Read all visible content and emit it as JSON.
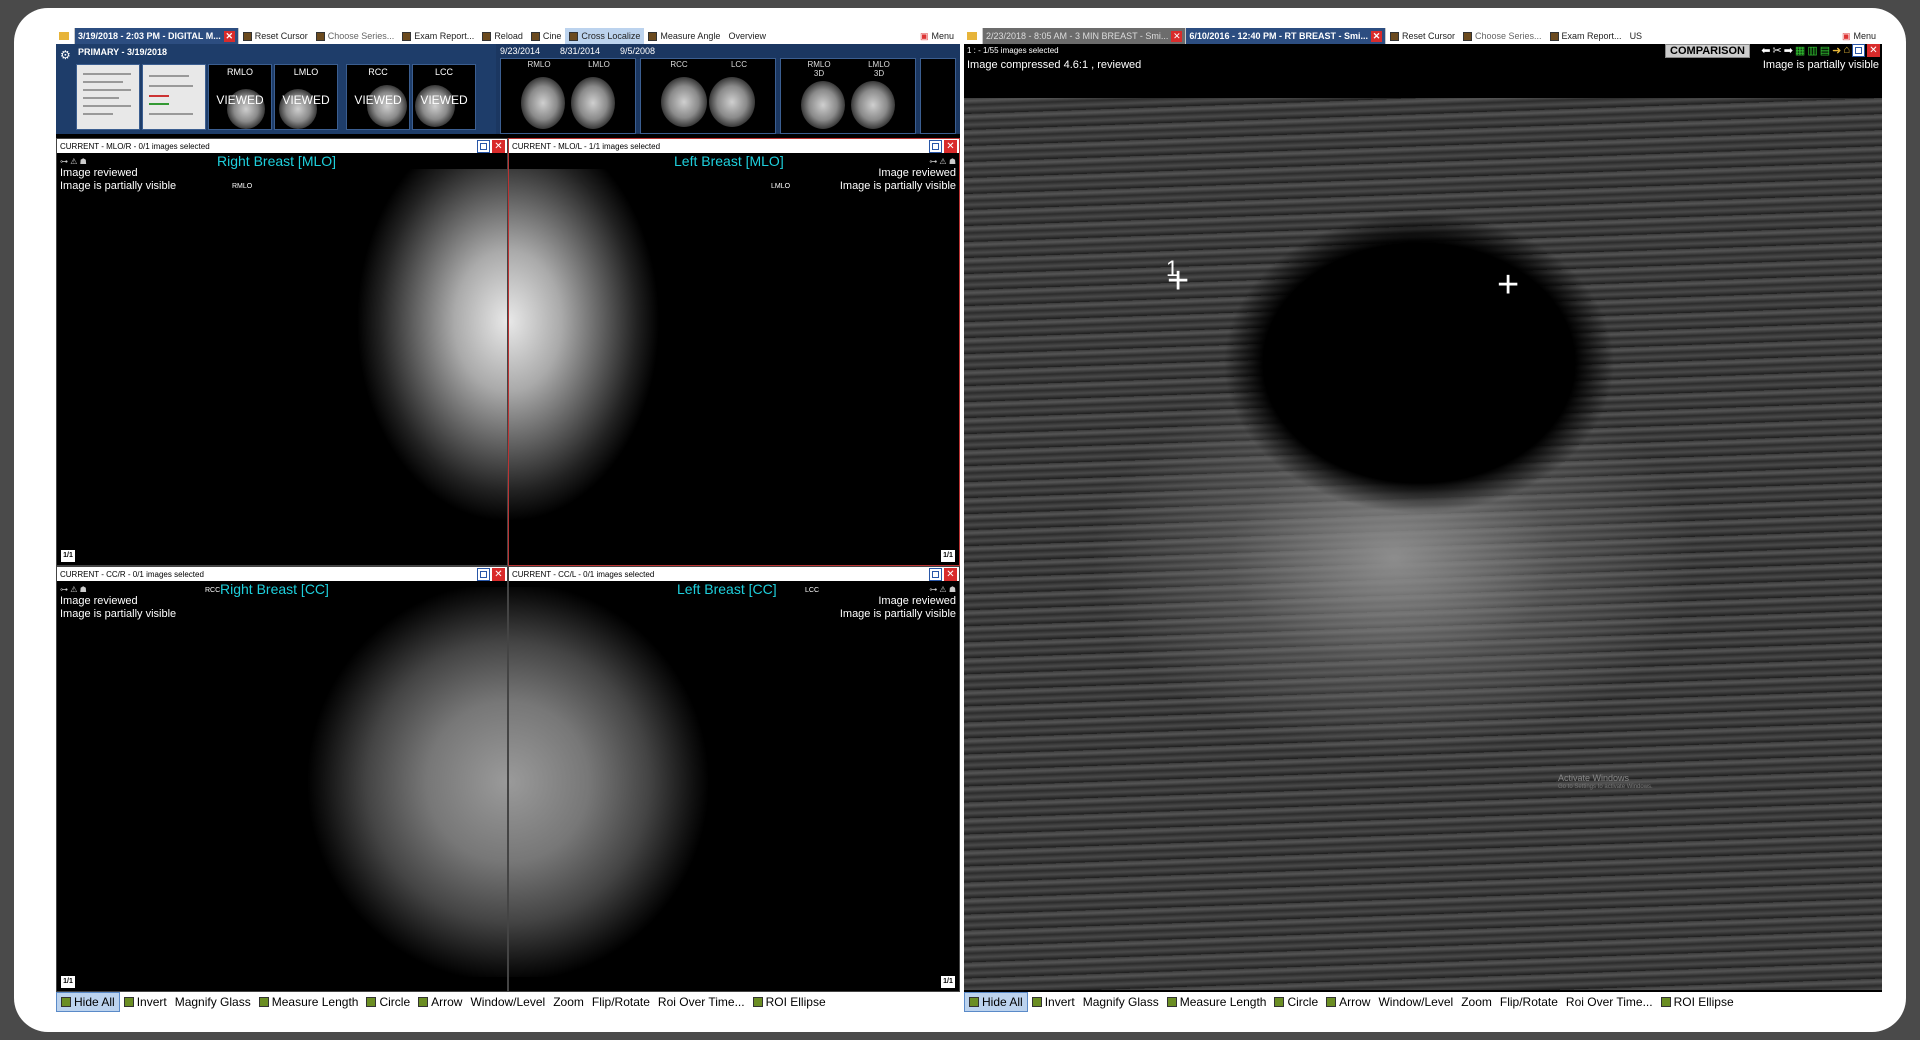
{
  "left_window": {
    "tabs": [
      {
        "label": "3/19/2018 - 2:03 PM - DIGITAL M..."
      }
    ],
    "toolbar": {
      "reset_cursor": "Reset Cursor",
      "choose_series": "Choose Series...",
      "exam_report": "Exam Report...",
      "reload": "Reload",
      "cine": "Cine",
      "cross_localize": "Cross Localize",
      "measure_angle": "Measure Angle",
      "overview": "Overview",
      "menu": "Menu"
    },
    "primary": {
      "header": "PRIMARY - 3/19/2018",
      "thumbs": [
        {
          "label": "RMLO",
          "status": "VIEWED"
        },
        {
          "label": "LMLO",
          "status": "VIEWED"
        },
        {
          "label": "RCC",
          "status": "VIEWED"
        },
        {
          "label": "LCC",
          "status": "VIEWED"
        }
      ]
    },
    "comparison_dates": [
      "9/23/2014",
      "8/31/2014",
      "9/5/2008"
    ],
    "comparison_thumbs": [
      {
        "label": "RMLO"
      },
      {
        "label": "LMLO"
      },
      {
        "label": "RCC"
      },
      {
        "label": "LCC"
      },
      {
        "label": "RMLO\n3D"
      },
      {
        "label": "LMLO\n3D"
      }
    ],
    "viewports": [
      {
        "header": "CURRENT - MLO/R - 0/1 images selected",
        "title": "Right Breast [MLO]",
        "status1": "Image reviewed",
        "status2": "Image is partially visible",
        "orient": "RMLO",
        "page": "1/1"
      },
      {
        "header": "CURRENT - MLO/L - 1/1 images selected",
        "title": "Left Breast [MLO]",
        "status1": "Image reviewed",
        "status2": "Image is partially visible",
        "orient": "LMLO",
        "page": "1/1"
      },
      {
        "header": "CURRENT - CC/R - 0/1 images selected",
        "title": "Right Breast [CC]",
        "status1": "Image reviewed",
        "status2": "Image is partially visible",
        "orient": "RCC",
        "page": "1/1"
      },
      {
        "header": "CURRENT - CC/L - 0/1 images selected",
        "title": "Left Breast [CC]",
        "status1": "Image reviewed",
        "status2": "Image is partially visible",
        "orient": "LCC",
        "page": "1/1"
      }
    ],
    "bottom_tools": [
      "Hide All",
      "Invert",
      "Magnify Glass",
      "Measure Length",
      "Circle",
      "Arrow",
      "Window/Level",
      "Zoom",
      "Flip/Rotate",
      "Roi Over Time...",
      "ROI Ellipse"
    ]
  },
  "right_window": {
    "tabs": [
      {
        "label": "2/23/2018 - 8:05 AM - 3 MIN BREAST - Smi..."
      },
      {
        "label": "6/10/2016 - 12:40 PM - RT BREAST - Smi..."
      }
    ],
    "toolbar": {
      "reset_cursor": "Reset Cursor",
      "choose_series": "Choose Series...",
      "exam_report": "Exam Report...",
      "modality": "US",
      "menu": "Menu"
    },
    "viewport": {
      "header": "1 : - 1/55 images selected",
      "comparison": "COMPARISON",
      "compression": "Image compressed 4.6:1 , reviewed",
      "status": "Image is partially visible",
      "marker": "1",
      "watermark1": "Activate Windows",
      "watermark2": "Go to Settings to activate Windows."
    },
    "bottom_tools": [
      "Hide All",
      "Invert",
      "Magnify Glass",
      "Measure Length",
      "Circle",
      "Arrow",
      "Window/Level",
      "Zoom",
      "Flip/Rotate",
      "Roi Over Time...",
      "ROI Ellipse"
    ]
  }
}
